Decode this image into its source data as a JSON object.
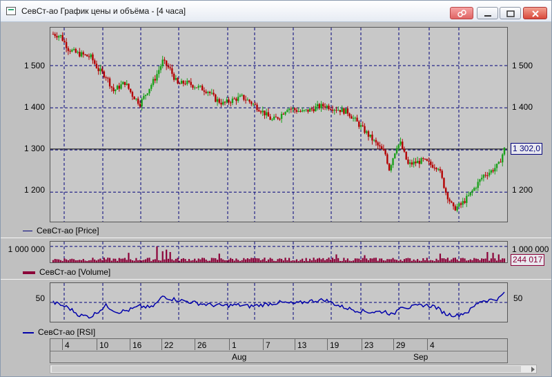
{
  "window": {
    "title": "СевСт-ао График цены и объёма - [4 часа]"
  },
  "colors": {
    "up": "#1aa01a",
    "down": "#b40000",
    "grid": "#00007a",
    "volume": "#8b0038",
    "rsi": "#0000aa",
    "last_price_line": "#000000"
  },
  "icons": {
    "app": "chart-window-icon",
    "link": "link-icon",
    "minimize": "minimize-icon",
    "maximize": "maximize-icon",
    "close": "close-icon"
  },
  "price_panel": {
    "legend": "СевСт-ао [Price]",
    "y_ticks": [
      "1 500",
      "1 400",
      "1 300",
      "1 200"
    ],
    "last_value": "1 302,0"
  },
  "volume_panel": {
    "legend": "СевСт-ао [Volume]",
    "y_tick": "1 000 000",
    "last_value": "244 017"
  },
  "rsi_panel": {
    "legend": "СевСт-ао [RSI]",
    "y_tick": "50"
  },
  "x_axis": {
    "days": [
      "4",
      "10",
      "16",
      "22",
      "26",
      "1",
      "7",
      "13",
      "19",
      "23",
      "29",
      "4"
    ],
    "months": [
      "Aug",
      "Sep"
    ]
  },
  "chart_data": [
    {
      "type": "candlestick",
      "series_name": "СевСт-ао [Price]",
      "ylim": [
        1130,
        1590
      ],
      "last": 1302.0,
      "anchors": [
        [
          0,
          1575
        ],
        [
          4,
          1570
        ],
        [
          8,
          1540
        ],
        [
          12,
          1530
        ],
        [
          16,
          1525
        ],
        [
          20,
          1520
        ],
        [
          24,
          1490
        ],
        [
          28,
          1475
        ],
        [
          32,
          1440
        ],
        [
          38,
          1460
        ],
        [
          42,
          1430
        ],
        [
          46,
          1410
        ],
        [
          50,
          1440
        ],
        [
          54,
          1470
        ],
        [
          58,
          1510
        ],
        [
          62,
          1490
        ],
        [
          66,
          1455
        ],
        [
          70,
          1460
        ],
        [
          76,
          1450
        ],
        [
          82,
          1440
        ],
        [
          86,
          1420
        ],
        [
          90,
          1410
        ],
        [
          96,
          1420
        ],
        [
          100,
          1425
        ],
        [
          104,
          1415
        ],
        [
          110,
          1395
        ],
        [
          116,
          1370
        ],
        [
          120,
          1380
        ],
        [
          124,
          1400
        ],
        [
          128,
          1395
        ],
        [
          132,
          1390
        ],
        [
          136,
          1395
        ],
        [
          140,
          1402
        ],
        [
          144,
          1405
        ],
        [
          148,
          1400
        ],
        [
          152,
          1395
        ],
        [
          156,
          1390
        ],
        [
          160,
          1370
        ],
        [
          164,
          1350
        ],
        [
          168,
          1330
        ],
        [
          172,
          1310
        ],
        [
          176,
          1290
        ],
        [
          178,
          1255
        ],
        [
          182,
          1310
        ],
        [
          184,
          1315
        ],
        [
          188,
          1265
        ],
        [
          192,
          1270
        ],
        [
          196,
          1275
        ],
        [
          200,
          1265
        ],
        [
          204,
          1260
        ],
        [
          208,
          1200
        ],
        [
          212,
          1160
        ],
        [
          216,
          1170
        ],
        [
          220,
          1190
        ],
        [
          224,
          1215
        ],
        [
          228,
          1240
        ],
        [
          232,
          1250
        ],
        [
          236,
          1265
        ],
        [
          239,
          1302
        ]
      ]
    },
    {
      "type": "bar",
      "series_name": "СевСт-ао [Volume]",
      "ylim": [
        0,
        1300000
      ],
      "last": 244017,
      "spikes": [
        [
          40,
          600000
        ],
        [
          55,
          1000000
        ],
        [
          58,
          700000
        ],
        [
          60,
          800000
        ],
        [
          62,
          650000
        ],
        [
          88,
          550000
        ],
        [
          150,
          500000
        ],
        [
          165,
          450000
        ],
        [
          205,
          550000
        ],
        [
          230,
          650000
        ],
        [
          233,
          600000
        ],
        [
          236,
          500000
        ]
      ]
    },
    {
      "type": "line",
      "series_name": "СевСт-ао [RSI]",
      "ylim": [
        20,
        80
      ],
      "anchors": [
        [
          0,
          50
        ],
        [
          8,
          42
        ],
        [
          14,
          30
        ],
        [
          20,
          28
        ],
        [
          28,
          45
        ],
        [
          34,
          35
        ],
        [
          40,
          38
        ],
        [
          46,
          44
        ],
        [
          52,
          42
        ],
        [
          56,
          52
        ],
        [
          58,
          60
        ],
        [
          62,
          56
        ],
        [
          70,
          52
        ],
        [
          78,
          48
        ],
        [
          84,
          46
        ],
        [
          90,
          45
        ],
        [
          98,
          46
        ],
        [
          104,
          44
        ],
        [
          110,
          46
        ],
        [
          120,
          50
        ],
        [
          128,
          48
        ],
        [
          136,
          52
        ],
        [
          144,
          54
        ],
        [
          152,
          44
        ],
        [
          160,
          38
        ],
        [
          168,
          35
        ],
        [
          176,
          36
        ],
        [
          180,
          30
        ],
        [
          184,
          45
        ],
        [
          188,
          42
        ],
        [
          196,
          46
        ],
        [
          202,
          44
        ],
        [
          208,
          32
        ],
        [
          214,
          30
        ],
        [
          220,
          36
        ],
        [
          226,
          52
        ],
        [
          232,
          54
        ],
        [
          236,
          56
        ],
        [
          239,
          65
        ]
      ]
    }
  ]
}
